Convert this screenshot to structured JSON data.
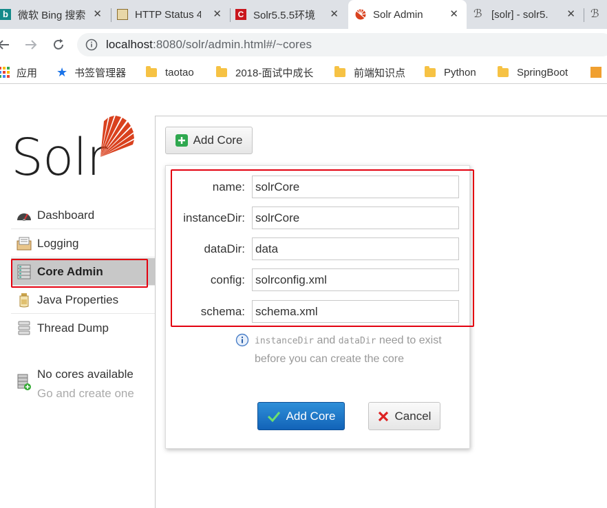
{
  "browser": {
    "tabs": [
      {
        "label": "微软 Bing 搜索",
        "active": false,
        "icon": "bing-icon"
      },
      {
        "label": "HTTP Status 4",
        "active": false,
        "icon": "tomcat-icon"
      },
      {
        "label": "Solr5.5.5环境",
        "active": false,
        "icon": "csdn-icon"
      },
      {
        "label": "Solr Admin",
        "active": true,
        "icon": "solr-icon"
      },
      {
        "label": "[solr] - solr5.",
        "active": false,
        "icon": "site-icon"
      }
    ],
    "url_host": "localhost",
    "url_rest": ":8080/solr/admin.html#/~cores",
    "bookmarks": [
      "应用",
      "书签管理器",
      "taotao",
      "2018-面试中成长",
      "前端知识点",
      "Python",
      "SpringBoot"
    ]
  },
  "app": {
    "logo_text": "Solr",
    "menu": [
      {
        "label": "Dashboard",
        "icon": "dashboard-icon"
      },
      {
        "label": "Logging",
        "icon": "logging-icon"
      },
      {
        "label": "Core Admin",
        "icon": "core-admin-icon",
        "selected": true
      },
      {
        "label": "Java Properties",
        "icon": "java-properties-icon"
      },
      {
        "label": "Thread Dump",
        "icon": "thread-dump-icon"
      }
    ],
    "no_cores_title": "No cores available",
    "no_cores_sub": "Go and create one",
    "add_core_label": "Add Core",
    "form": {
      "fields": [
        {
          "label": "name:",
          "value": "solrCore"
        },
        {
          "label": "instanceDir:",
          "value": "solrCore"
        },
        {
          "label": "dataDir:",
          "value": "data"
        },
        {
          "label": "config:",
          "value": "solrconfig.xml"
        },
        {
          "label": "schema:",
          "value": "schema.xml"
        }
      ],
      "hint_code1": "instanceDir",
      "hint_and": " and ",
      "hint_code2": "dataDir",
      "hint_rest": " need to exist before you can create the core",
      "submit_label": "Add Core",
      "cancel_label": "Cancel"
    }
  }
}
